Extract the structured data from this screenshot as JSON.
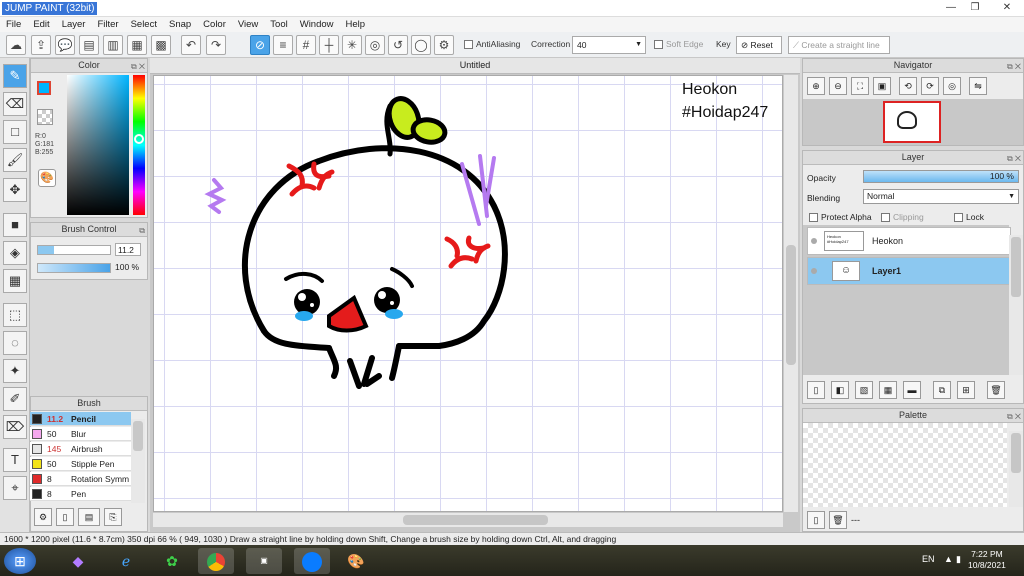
{
  "window": {
    "title": "JUMP PAINT (32bit)",
    "controls": [
      "—",
      "❐",
      "✕"
    ]
  },
  "menu": [
    "File",
    "Edit",
    "Layer",
    "Filter",
    "Select",
    "Snap",
    "Color",
    "View",
    "Tool",
    "Window",
    "Help"
  ],
  "toolbar": {
    "antialiasing_label": "AntiAliasing",
    "correction_label": "Correction",
    "correction_value": "40",
    "soft_edge_label": "Soft Edge",
    "key_label": "Key",
    "reset_label": "Reset",
    "straight_line_label": "Create a straight line"
  },
  "color_panel": {
    "title": "Color",
    "r": "R:0",
    "g": "G:181",
    "b": "B:255",
    "accent": "#00b5ff"
  },
  "brush_control": {
    "title": "Brush Control",
    "size": "11.2",
    "opacity": "100 %"
  },
  "brush_panel": {
    "title": "Brush",
    "items": [
      {
        "size": "11.2",
        "name": "Pencil",
        "color": "#222222"
      },
      {
        "size": "50",
        "name": "Blur",
        "color": "#f4a8ee"
      },
      {
        "size": "145",
        "name": "Airbrush",
        "color": "#e6e6e6"
      },
      {
        "size": "50",
        "name": "Stipple Pen",
        "color": "#f2e31a"
      },
      {
        "size": "8",
        "name": "Rotation Symm",
        "color": "#e02a2a"
      },
      {
        "size": "8",
        "name": "Pen",
        "color": "#222222"
      }
    ]
  },
  "canvas": {
    "tab_title": "Untitled",
    "text_line1": "Heokon",
    "text_line2": "#Hoidap247"
  },
  "navigator": {
    "title": "Navigator"
  },
  "layer_panel": {
    "title": "Layer",
    "opacity_label": "Opacity",
    "opacity_value": "100 %",
    "blending_label": "Blending",
    "blending_value": "Normal",
    "protect_alpha": "Protect Alpha",
    "clipping": "Clipping",
    "lock": "Lock",
    "layers": [
      {
        "name": "Heokon",
        "thumb": "Heokon\n#Hoidap247"
      },
      {
        "name": "Layer1",
        "thumb": ""
      }
    ]
  },
  "palette_panel": {
    "title": "Palette",
    "footer": "---"
  },
  "status": "1600 * 1200 pixel   (11.6 * 8.7cm)   350 dpi   66 %   ( 949, 1030 )   Draw a straight line by holding down Shift, Change a brush size by holding down Ctrl, Alt, and dragging",
  "taskbar": {
    "lang": "EN",
    "time": "7:22 PM",
    "date": "10/8/2021"
  }
}
